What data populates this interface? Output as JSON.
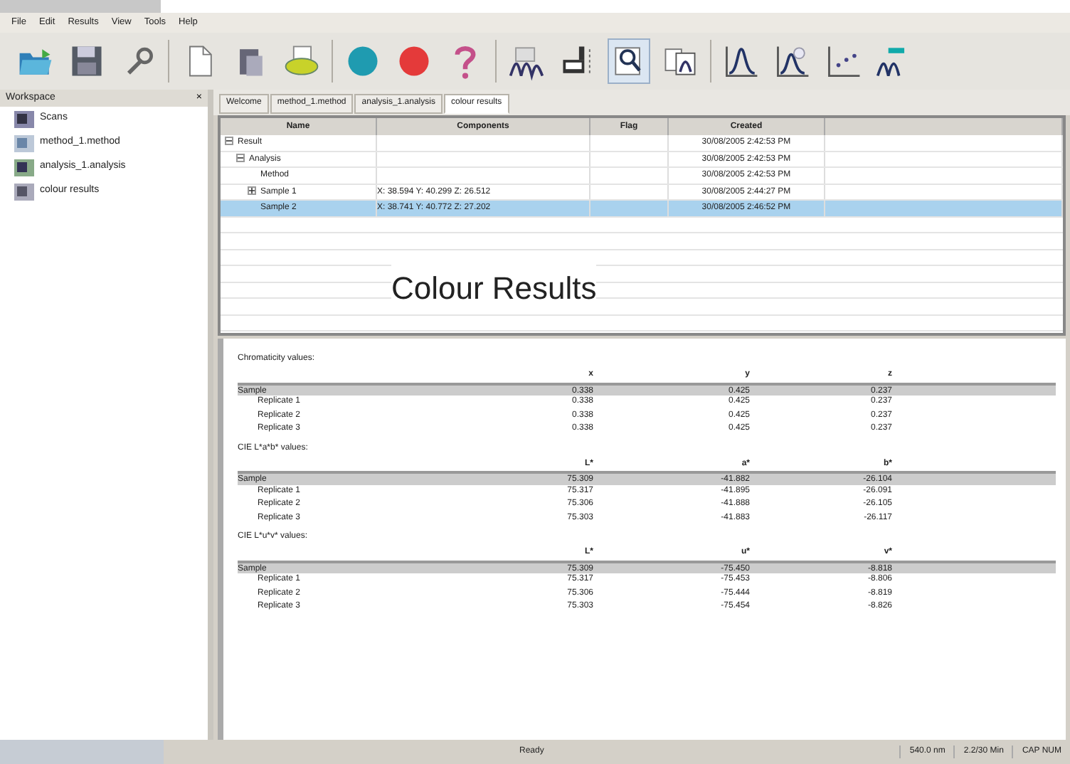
{
  "menu": [
    "File",
    "Edit",
    "Results",
    "View",
    "Tools",
    "Help"
  ],
  "toolbar": [
    {
      "kind": "open",
      "pressed": false
    },
    {
      "kind": "save",
      "pressed": false
    },
    {
      "kind": "wrench",
      "pressed": false
    },
    {
      "kind": "separator"
    },
    {
      "kind": "new",
      "pressed": false
    },
    {
      "kind": "paste",
      "pressed": false
    },
    {
      "kind": "print",
      "pressed": false
    },
    {
      "kind": "separator"
    },
    {
      "kind": "start",
      "pressed": false
    },
    {
      "kind": "stop",
      "pressed": false
    },
    {
      "kind": "help",
      "pressed": false
    },
    {
      "kind": "separator"
    },
    {
      "kind": "scan",
      "pressed": false
    },
    {
      "kind": "holder",
      "pressed": false
    },
    {
      "kind": "zoom",
      "pressed": true
    },
    {
      "kind": "report",
      "pressed": false
    },
    {
      "kind": "separator"
    },
    {
      "kind": "peak",
      "pressed": false
    },
    {
      "kind": "peakpick",
      "pressed": false
    },
    {
      "kind": "scatter",
      "pressed": false
    },
    {
      "kind": "more",
      "pressed": false
    }
  ],
  "workspace": {
    "title": "Workspace",
    "close": "×",
    "items": [
      {
        "label": "Scans",
        "kind": "scans"
      },
      {
        "label": "method_1.method",
        "kind": "method"
      },
      {
        "label": "analysis_1.analysis",
        "kind": "analysis"
      },
      {
        "label": "colour results",
        "kind": "results"
      }
    ]
  },
  "tabs": [
    {
      "label": "Welcome",
      "selected": false
    },
    {
      "label": "method_1.method",
      "selected": false
    },
    {
      "label": "analysis_1.analysis",
      "selected": false
    },
    {
      "label": "colour results",
      "selected": true
    }
  ],
  "grid": {
    "columns": [
      "Name",
      "Components",
      "Flag",
      "Created"
    ],
    "rows": [
      {
        "name": "Result",
        "created": "30/08/2005 2:42:53 PM",
        "selected": false,
        "expanded": true,
        "children": [
          {
            "name": "Analysis",
            "created": "30/08/2005 2:42:53 PM",
            "selected": false,
            "expanded": true,
            "children": [
              {
                "name": "Method",
                "created": "30/08/2005 2:42:53 PM",
                "selected": false
              },
              {
                "name": "Sample 1",
                "components": "X: 38.594  Y: 40.299  Z: 26.512",
                "created": "30/08/2005 2:44:27 PM",
                "selected": false,
                "expanded": false
              },
              {
                "name": "Sample 2",
                "components": "X: 38.741  Y: 40.772  Z: 27.202",
                "created": "30/08/2005 2:46:52 PM",
                "selected": true
              }
            ]
          }
        ]
      }
    ],
    "caption": "Colour Results"
  },
  "report": [
    {
      "title": "Chromaticity values:",
      "columns": [
        "x",
        "y",
        "z"
      ],
      "rows": [
        {
          "label": "Sample",
          "kind": "sample",
          "values": [
            "0.338",
            "0.425",
            "0.237"
          ]
        },
        {
          "label": "Replicate 1",
          "kind": "replicate",
          "values": [
            "0.338",
            "0.425",
            "0.237"
          ]
        },
        {
          "label": "Replicate 2",
          "kind": "replicate",
          "values": [
            "0.338",
            "0.425",
            "0.237"
          ]
        },
        {
          "label": "Replicate 3",
          "kind": "replicate",
          "values": [
            "0.338",
            "0.425",
            "0.237"
          ]
        }
      ]
    },
    {
      "title": "CIE L*a*b* values:",
      "columns": [
        "L*",
        "a*",
        "b*"
      ],
      "rows": [
        {
          "label": "Sample",
          "kind": "sample",
          "values": [
            "75.309",
            "-41.882",
            "-26.104"
          ]
        },
        {
          "label": "Replicate 1",
          "kind": "replicate",
          "values": [
            "75.317",
            "-41.895",
            "-26.091"
          ]
        },
        {
          "label": "Replicate 2",
          "kind": "replicate",
          "values": [
            "75.306",
            "-41.888",
            "-26.105"
          ]
        },
        {
          "label": "Replicate 3",
          "kind": "replicate",
          "values": [
            "75.303",
            "-41.883",
            "-26.117"
          ]
        }
      ]
    },
    {
      "title": "CIE L*u*v* values:",
      "columns": [
        "L*",
        "u*",
        "v*"
      ],
      "rows": [
        {
          "label": "Sample",
          "kind": "sample",
          "values": [
            "75.309",
            "-75.450",
            "-8.818"
          ]
        },
        {
          "label": "Replicate 1",
          "kind": "replicate",
          "values": [
            "75.317",
            "-75.453",
            "-8.806"
          ]
        },
        {
          "label": "Replicate 2",
          "kind": "replicate",
          "values": [
            "75.306",
            "-75.444",
            "-8.819"
          ]
        },
        {
          "label": "Replicate 3",
          "kind": "replicate",
          "values": [
            "75.303",
            "-75.454",
            "-8.826"
          ]
        }
      ]
    }
  ],
  "status_bar": [
    "Ready",
    "540.0 nm",
    "2.2/30 Min",
    "CAP NUM"
  ]
}
